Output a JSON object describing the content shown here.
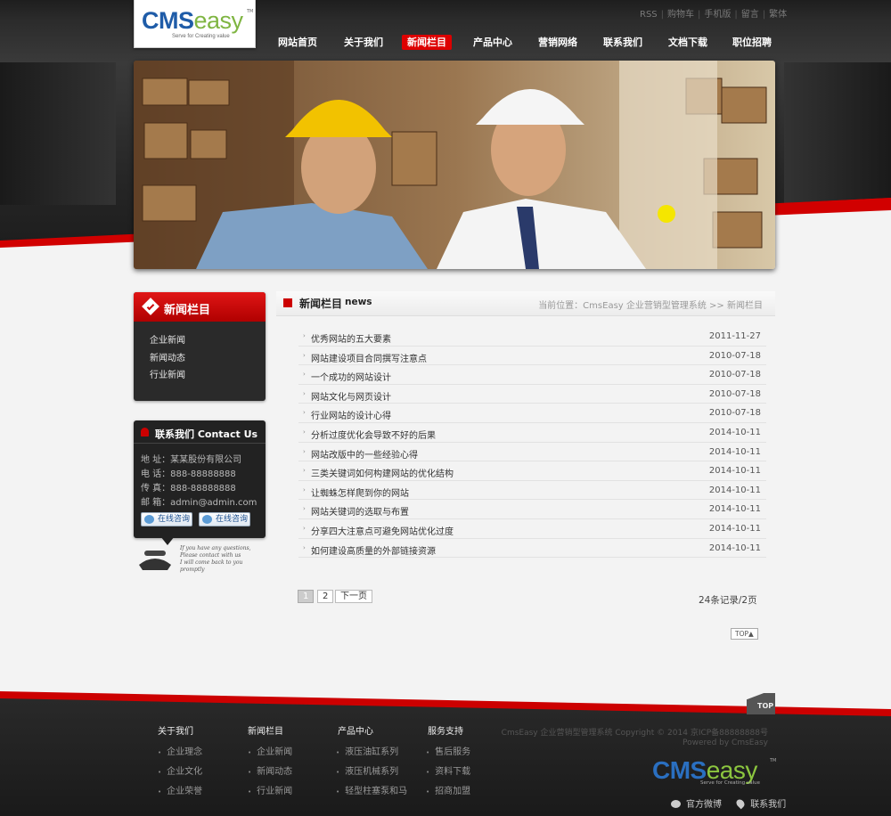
{
  "logo": {
    "cms": "CMS",
    "easy": "easy",
    "tagline": "Serve for Creating value",
    "tm": "TM"
  },
  "top_links": [
    "RSS",
    "购物车",
    "手机版",
    "留言",
    "繁体"
  ],
  "nav": {
    "items": [
      "网站首页",
      "关于我们",
      "新闻栏目",
      "产品中心",
      "营销网络",
      "联系我们",
      "文档下载",
      "职位招聘"
    ],
    "active_index": 2,
    "active_color": "#dd0000"
  },
  "sidebar_news": {
    "title": "新闻栏目",
    "items": [
      "企业新闻",
      "新闻动态",
      "行业新闻"
    ]
  },
  "contact": {
    "title": "联系我们 Contact Us",
    "rows": [
      "地  址：某某股份有限公司",
      "电  话：888-88888888",
      "传  真：888-88888888",
      "邮  箱：admin@admin.com"
    ],
    "buttons": [
      "在线咨询",
      "在线咨询"
    ],
    "deco_lines": [
      "If you have any questions,",
      "Please contact with us",
      "I will come back to you promptly"
    ]
  },
  "content": {
    "title": "新闻栏目",
    "subtitle": "news",
    "breadcrumb": "当前位置：CmsEasy 企业营销型管理系统  >>  新闻栏目",
    "articles": [
      {
        "title": "优秀网站的五大要素",
        "date": "2011-11-27"
      },
      {
        "title": "网站建设项目合同撰写注意点",
        "date": "2010-07-18"
      },
      {
        "title": "一个成功的网站设计",
        "date": "2010-07-18"
      },
      {
        "title": "网站文化与网页设计",
        "date": "2010-07-18"
      },
      {
        "title": "行业网站的设计心得",
        "date": "2010-07-18"
      },
      {
        "title": "分析过度优化会导致不好的后果",
        "date": "2014-10-11"
      },
      {
        "title": "网站改版中的一些经验心得",
        "date": "2014-10-11"
      },
      {
        "title": "三类关键词如何构建网站的优化结构",
        "date": "2014-10-11"
      },
      {
        "title": "让蜘蛛怎样爬到你的网站",
        "date": "2014-10-11"
      },
      {
        "title": "网站关键词的选取与布置",
        "date": "2014-10-11"
      },
      {
        "title": "分享四大注意点可避免网站优化过度",
        "date": "2014-10-11"
      },
      {
        "title": "如何建设高质量的外部链接资源",
        "date": "2014-10-11"
      }
    ],
    "pager": {
      "pages": [
        "1",
        "2"
      ],
      "current": "1",
      "next": "下一页"
    },
    "records": "24条记录/2页",
    "top_button": "TOP▲"
  },
  "footer": {
    "top_tab": "TOP",
    "columns": [
      {
        "head": "关于我们",
        "items": [
          "企业理念",
          "企业文化",
          "企业荣誉"
        ]
      },
      {
        "head": "新闻栏目",
        "items": [
          "企业新闻",
          "新闻动态",
          "行业新闻"
        ]
      },
      {
        "head": "产品中心",
        "items": [
          "液压油缸系列",
          "液压机械系列",
          "轻型柱塞泵和马"
        ]
      },
      {
        "head": "服务支持",
        "items": [
          "售后服务",
          "资料下载",
          "招商加盟"
        ]
      }
    ],
    "copyright_line1": "CmsEasy 企业营销型管理系统 Copyright © 2014 京ICP备88888888号",
    "copyright_line2": "Powered by CmsEasy",
    "logo": {
      "cms": "CMS",
      "easy": "easy",
      "tagline": "Serve for Creating value",
      "tm": "TM"
    },
    "links": [
      "官方微博",
      "联系我们"
    ]
  },
  "colors": {
    "accent": "#cc0000",
    "dark": "#222222",
    "page_bg": "#f3f3f3"
  }
}
